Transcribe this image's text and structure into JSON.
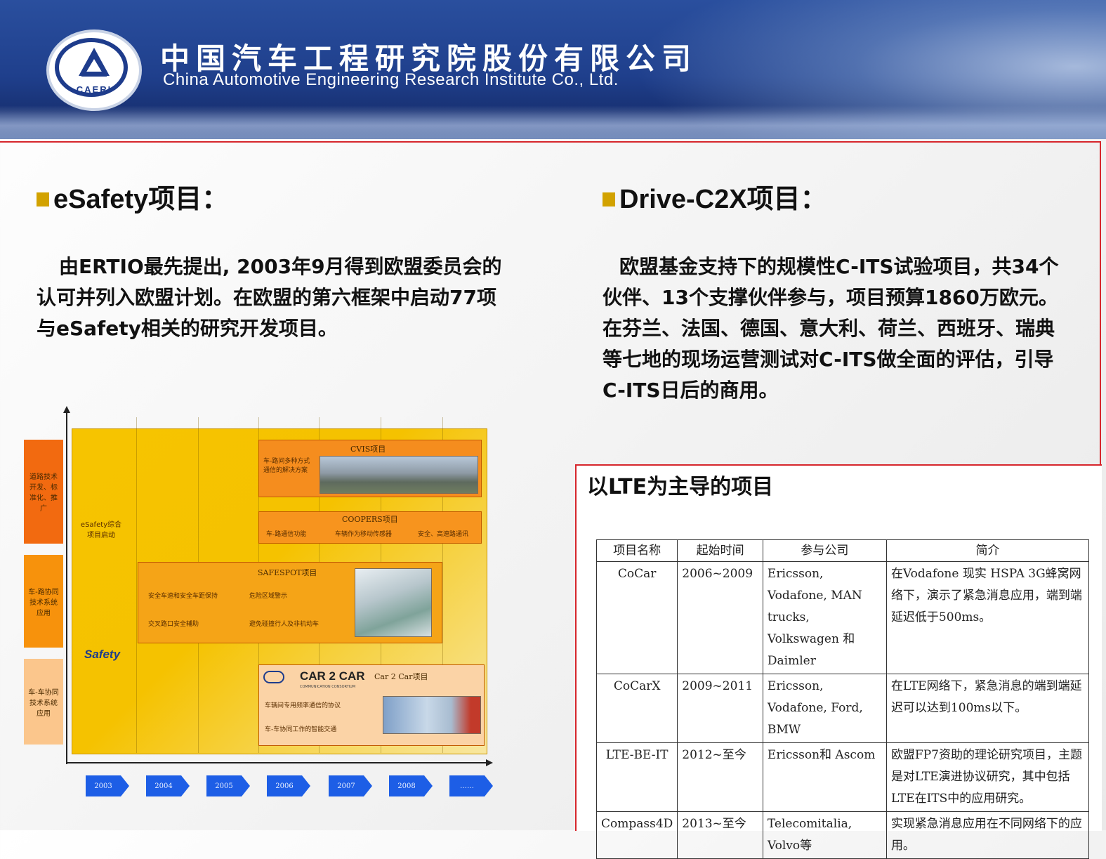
{
  "header": {
    "company_cn": "中国汽车工程研究院股份有限公司",
    "company_en": "China Automotive Engineering Research Institute Co., Ltd.",
    "logo_text": "CAERI"
  },
  "esafety": {
    "title": "eSafety项目：",
    "lines": [
      "由ERTIO最先提出, 2003年9月得到欧盟委员会的",
      "认可并列入欧盟计划。在欧盟的第六框架中启动77项",
      "与eSafety相关的研究开发项目。"
    ]
  },
  "drive": {
    "title": "Drive-C2X项目：",
    "lines": [
      "欧盟基金支持下的规模性C-ITS试验项目，共34个",
      "伙伴、13个支撑伙伴参与，项目预算1860万欧元。",
      "在芬兰、法国、德国、意大利、荷兰、西班牙、瑞典",
      "等七地的现场运营测试对C-ITS做全面的评估，引导",
      "C-ITS日后的商用。"
    ]
  },
  "timeline": {
    "categories": [
      "道路技术开发、标准化、推广",
      "车-路协同技术系统应用",
      "车-车协同技术系统应用"
    ],
    "esafety_start": "eSafety综合项目启动",
    "esafety_logo": "Safety",
    "cvis": {
      "title": "CVIS项目",
      "text": "车-路间多种方式通信的解决方案"
    },
    "coopers": {
      "title": "COOPERS项目",
      "items": [
        "车-路通信功能",
        "车辆作为移动传感器",
        "安全、高速路通讯"
      ]
    },
    "safespot": {
      "title": "SAFESPOT项目",
      "items": [
        "安全车速和安全车距保持",
        "危险区域警示",
        "交叉路口安全辅助",
        "避免碰撞行人及非机动车"
      ]
    },
    "car2car": {
      "logo": "CAR 2 CAR",
      "logo_sub": "COMMUNICATION CONSORTIUM",
      "title": "Car 2 Car项目",
      "items": [
        "车辆间专用频率通信的协议",
        "车-车协同工作的智能交通"
      ]
    },
    "years": [
      "2003",
      "2004",
      "2005",
      "2006",
      "2007",
      "2008",
      "……"
    ]
  },
  "lte": {
    "title": "以LTE为主导的项目",
    "headers": [
      "项目名称",
      "起始时间",
      "参与公司",
      "简介"
    ],
    "rows": [
      {
        "name": "CoCar",
        "time": "2006~2009",
        "companies": "Ericsson, Vodafone, MAN trucks, Volkswagen 和 Daimler",
        "desc": "在Vodafone 现实 HSPA 3G蜂窝网络下，演示了紧急消息应用，端到端延迟低于500ms。"
      },
      {
        "name": "CoCarX",
        "time": "2009~2011",
        "companies": "Ericsson, Vodafone, Ford, BMW",
        "desc": "在LTE网络下，紧急消息的端到端延迟可以达到100ms以下。"
      },
      {
        "name": "LTE-BE-IT",
        "time": "2012~至今",
        "companies": "Ericsson和 Ascom",
        "desc": "欧盟FP7资助的理论研究项目，主题是对LTE演进协议研究，其中包括LTE在ITS中的应用研究。"
      },
      {
        "name": "Compass4D",
        "time": "2013~至今",
        "companies": "Telecomitalia, Volvo等",
        "desc": "实现紧急消息应用在不同网络下的应用。"
      }
    ]
  },
  "colors": {
    "banner": "#1f3f8c",
    "frame": "#d6262c",
    "bullet": "#d2a200",
    "timeline_bg": "#f6c400",
    "arrow": "#1d5ee6"
  }
}
